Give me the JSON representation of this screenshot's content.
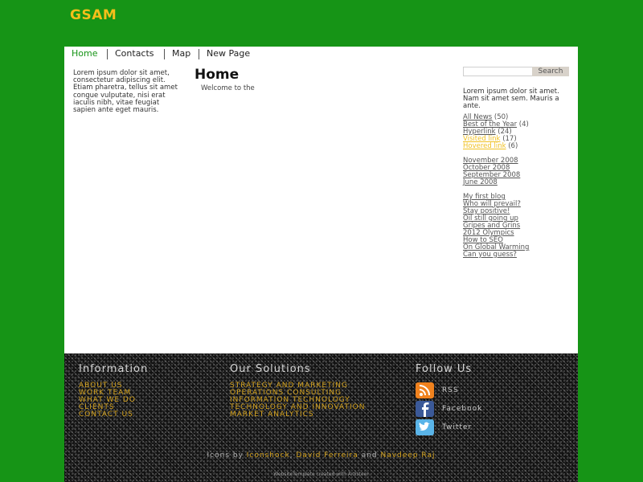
{
  "site": {
    "title": "GSAM"
  },
  "nav": {
    "items": [
      "Home",
      "Contacts",
      "Map",
      "New Page"
    ]
  },
  "left": {
    "text": "Lorem ipsum dolor sit amet, consectetur adipiscing elit. Etiam pharetra, tellus sit amet congue vulputate, nisi erat iaculis nibh, vitae feugiat sapien ante eget mauris."
  },
  "main": {
    "heading": "Home",
    "welcome": "Welcome to the"
  },
  "search": {
    "placeholder": "",
    "button": "Search"
  },
  "right": {
    "text": "Lorem ipsum dolor sit amet. Nam sit amet sem. Mauris a ante.",
    "categories": [
      {
        "label": "All News",
        "count": "(50)"
      },
      {
        "label": "Best of the Year",
        "count": "(4)"
      },
      {
        "label": "Hyperlink",
        "count": "(24)"
      },
      {
        "label": "Visited link",
        "count": "(17)"
      },
      {
        "label": "Hovered link",
        "count": "(6)"
      }
    ],
    "archives": [
      "November 2008",
      "October 2008",
      "September 2008",
      "June 2008"
    ],
    "posts": [
      "My first blog",
      "Who will prevail?",
      "Stay positive!",
      "Oil still going up",
      "Gripes and Grins",
      "2012 Olympics",
      "How to SEO",
      "On Global Warming",
      "Can you guess?"
    ]
  },
  "footer": {
    "information": {
      "heading": "Information",
      "links": [
        "ABOUT US",
        "WORK TEAM",
        "WHAT WE DO",
        "CLIENTS",
        "CONTACT US"
      ]
    },
    "solutions": {
      "heading": "Our Solutions",
      "links": [
        "STRATEGY AND MARKETING",
        "OPERATIONS CONSULTING",
        "INFORMATION TECHNOLOGY",
        "TECHNOLOGY AND INNOVATION",
        "MARKET ANALYTICS"
      ]
    },
    "follow": {
      "heading": "Follow Us",
      "items": [
        {
          "label": "RSS",
          "icon": "rss-icon"
        },
        {
          "label": "Facebook",
          "icon": "facebook-icon"
        },
        {
          "label": "Twitter",
          "icon": "twitter-icon"
        }
      ]
    },
    "credits": {
      "prefix": "Icons by",
      "name1": "Iconshock",
      "comma": ",",
      "name2": "David Ferreira",
      "and": "and",
      "name3": "Navdeep Raj"
    },
    "bottom": "WebsiteTemplate created with Artisteer"
  },
  "colors": {
    "background": "#169416",
    "accent": "#f5bf1a",
    "footer_link": "#d4a21e"
  }
}
